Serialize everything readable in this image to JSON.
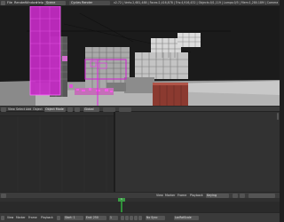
{
  "topbar": {
    "menus": [
      "File",
      "Render",
      "Window",
      "Help"
    ],
    "screen": "Scene",
    "scene": "Scene",
    "engine": "Cycles Render",
    "stats": "v2.72 | Verts:2,681,488 | Faces:2,416,878 | Tris:4,916,432 | Objects:0/1,119 | Lamps:0/5 | Mem:1,280.18M | Camera"
  },
  "viewport_header": {
    "view": "View",
    "select": "Select",
    "add": "Add",
    "object": "Object",
    "mode": "Object Mode",
    "layer_label": "Global"
  },
  "timeline_header": {
    "view": "View",
    "marker": "Marker",
    "frame": "Frame",
    "playback": "Playback",
    "keying": "Keying"
  },
  "bottombar": {
    "view": "View",
    "marker": "Marker",
    "frame": "Frame",
    "playback": "Playback",
    "start_label": "Start:",
    "start": "1",
    "end_label": "End:",
    "end": "250",
    "current_frame": "1",
    "sync": "No Sync",
    "keying_set": "LocRotScale"
  },
  "colors": {
    "accent_magenta": "#e01ee0",
    "frame_cursor": "#2f8f39",
    "panel": "#3a3a3a"
  }
}
